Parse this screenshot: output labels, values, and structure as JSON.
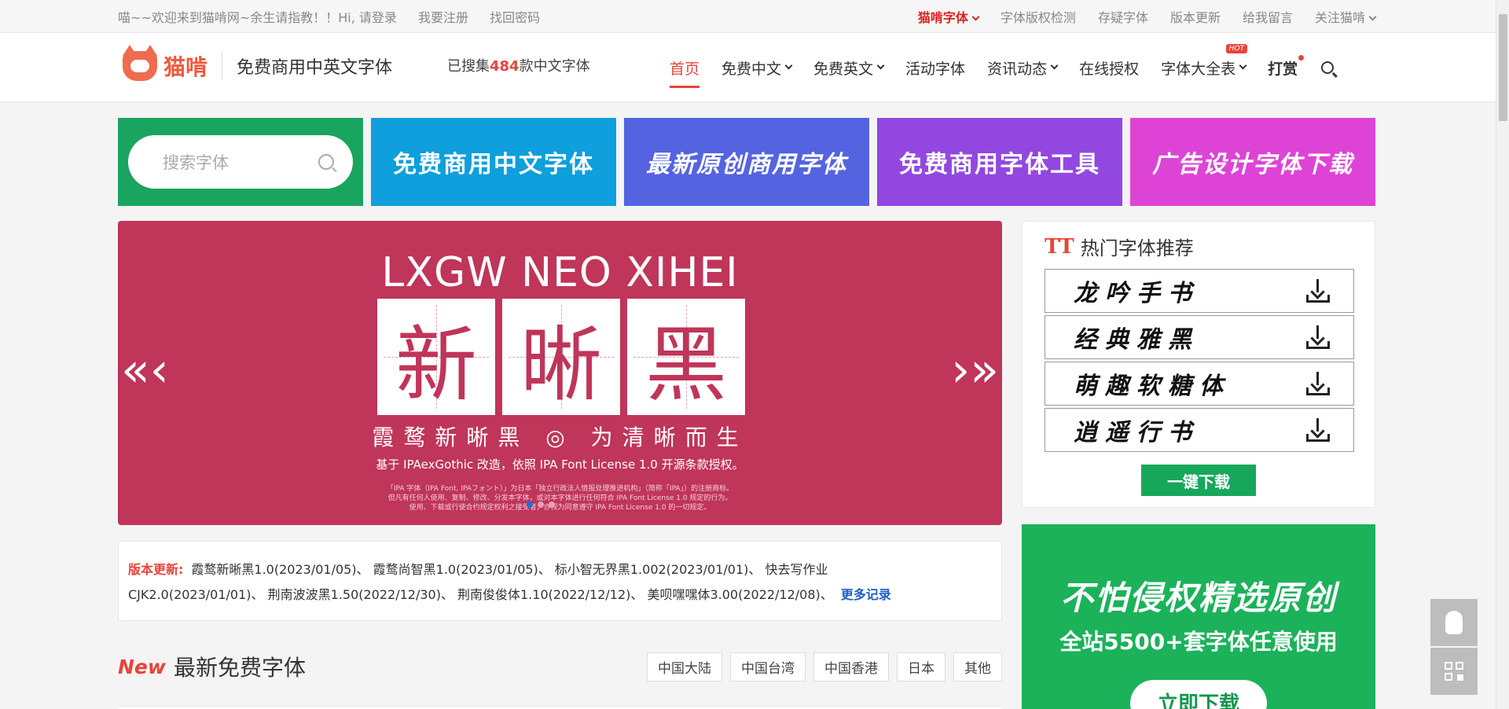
{
  "topbar": {
    "welcome": "喵~~欢迎来到猫啃网~余生请指教！！Hi, 请登录",
    "register": "我要注册",
    "recover": "找回密码",
    "right_items": [
      "猫啃字体",
      "字体版权检测",
      "存疑字体",
      "版本更新",
      "给我留言",
      "关注猫啃"
    ]
  },
  "header": {
    "logo_text": "猫啃",
    "slogan": "免费商用中英文字体",
    "count_prefix": "已搜集",
    "count_value": "484",
    "count_suffix": "款中文字体",
    "nav": [
      "首页",
      "免费中文",
      "免费英文",
      "活动字体",
      "资讯动态",
      "在线授权",
      "字体大全表",
      "打赏"
    ],
    "hot_badge": "HOT"
  },
  "tiles": {
    "search_placeholder": "搜索字体",
    "items": [
      "免费商用中文字体",
      "最新原创商用字体",
      "免费商用字体工具",
      "广告设计字体下载"
    ]
  },
  "slider": {
    "title": "LXGW NEO XIHEI",
    "glyphs": [
      "新",
      "晰",
      "黑"
    ],
    "subtitle": "霞鹜新晰黑 ◎ 为清晰而生",
    "note": "基于 IPAexGothic 改造，依照 IPA Font License 1.0 开源条款授权。",
    "fine_1": "「IPA 字体（IPA Font, IPAフォント）」为日本「独立行政法人情报处理推进机构」（简称「IPA」）的注册商标。",
    "fine_2": "但凡有任何人使用、复制、修改、分发本字体，或对本字体进行任何符合 IPA Font License 1.0 规定的行为。",
    "fine_3": "使用、下载或行使合约规定权利之接受者，亦视为同意遵守 IPA Font License 1.0 的一切规定。",
    "prev": "«‹",
    "next": "›»"
  },
  "updates": {
    "label": "版本更新:",
    "line1": "霞鹜新晰黑1.0(2023/01/05)、 霞鹜尚智黑1.0(2023/01/05)、 标小智无界黑1.002(2023/01/01)、 快去写作业",
    "line2": "CJK2.0(2023/01/01)、 荆南波波黑1.50(2022/12/30)、 荆南俊俊体1.10(2022/12/12)、 美呗嘿嘿体3.00(2022/12/08)、",
    "more": "更多记录"
  },
  "section": {
    "badge": "New",
    "title": "最新免费字体",
    "regions": [
      "中国大陆",
      "中国台湾",
      "中国香港",
      "日本",
      "其他"
    ]
  },
  "recommend": {
    "icon": "TT",
    "title": "热门字体推荐",
    "fonts": [
      "龙吟手书",
      "经典雅黑",
      "萌趣软糖体",
      "逍遥行书"
    ],
    "one_click": "一键下载"
  },
  "ad": {
    "line1": "不怕侵权精选原创",
    "line2": "全站5500+套字体任意使用",
    "button": "立即下载"
  },
  "colors": {
    "accent": "#e8443a",
    "slider_bg": "#c0355a",
    "green": "#1bb25a"
  }
}
